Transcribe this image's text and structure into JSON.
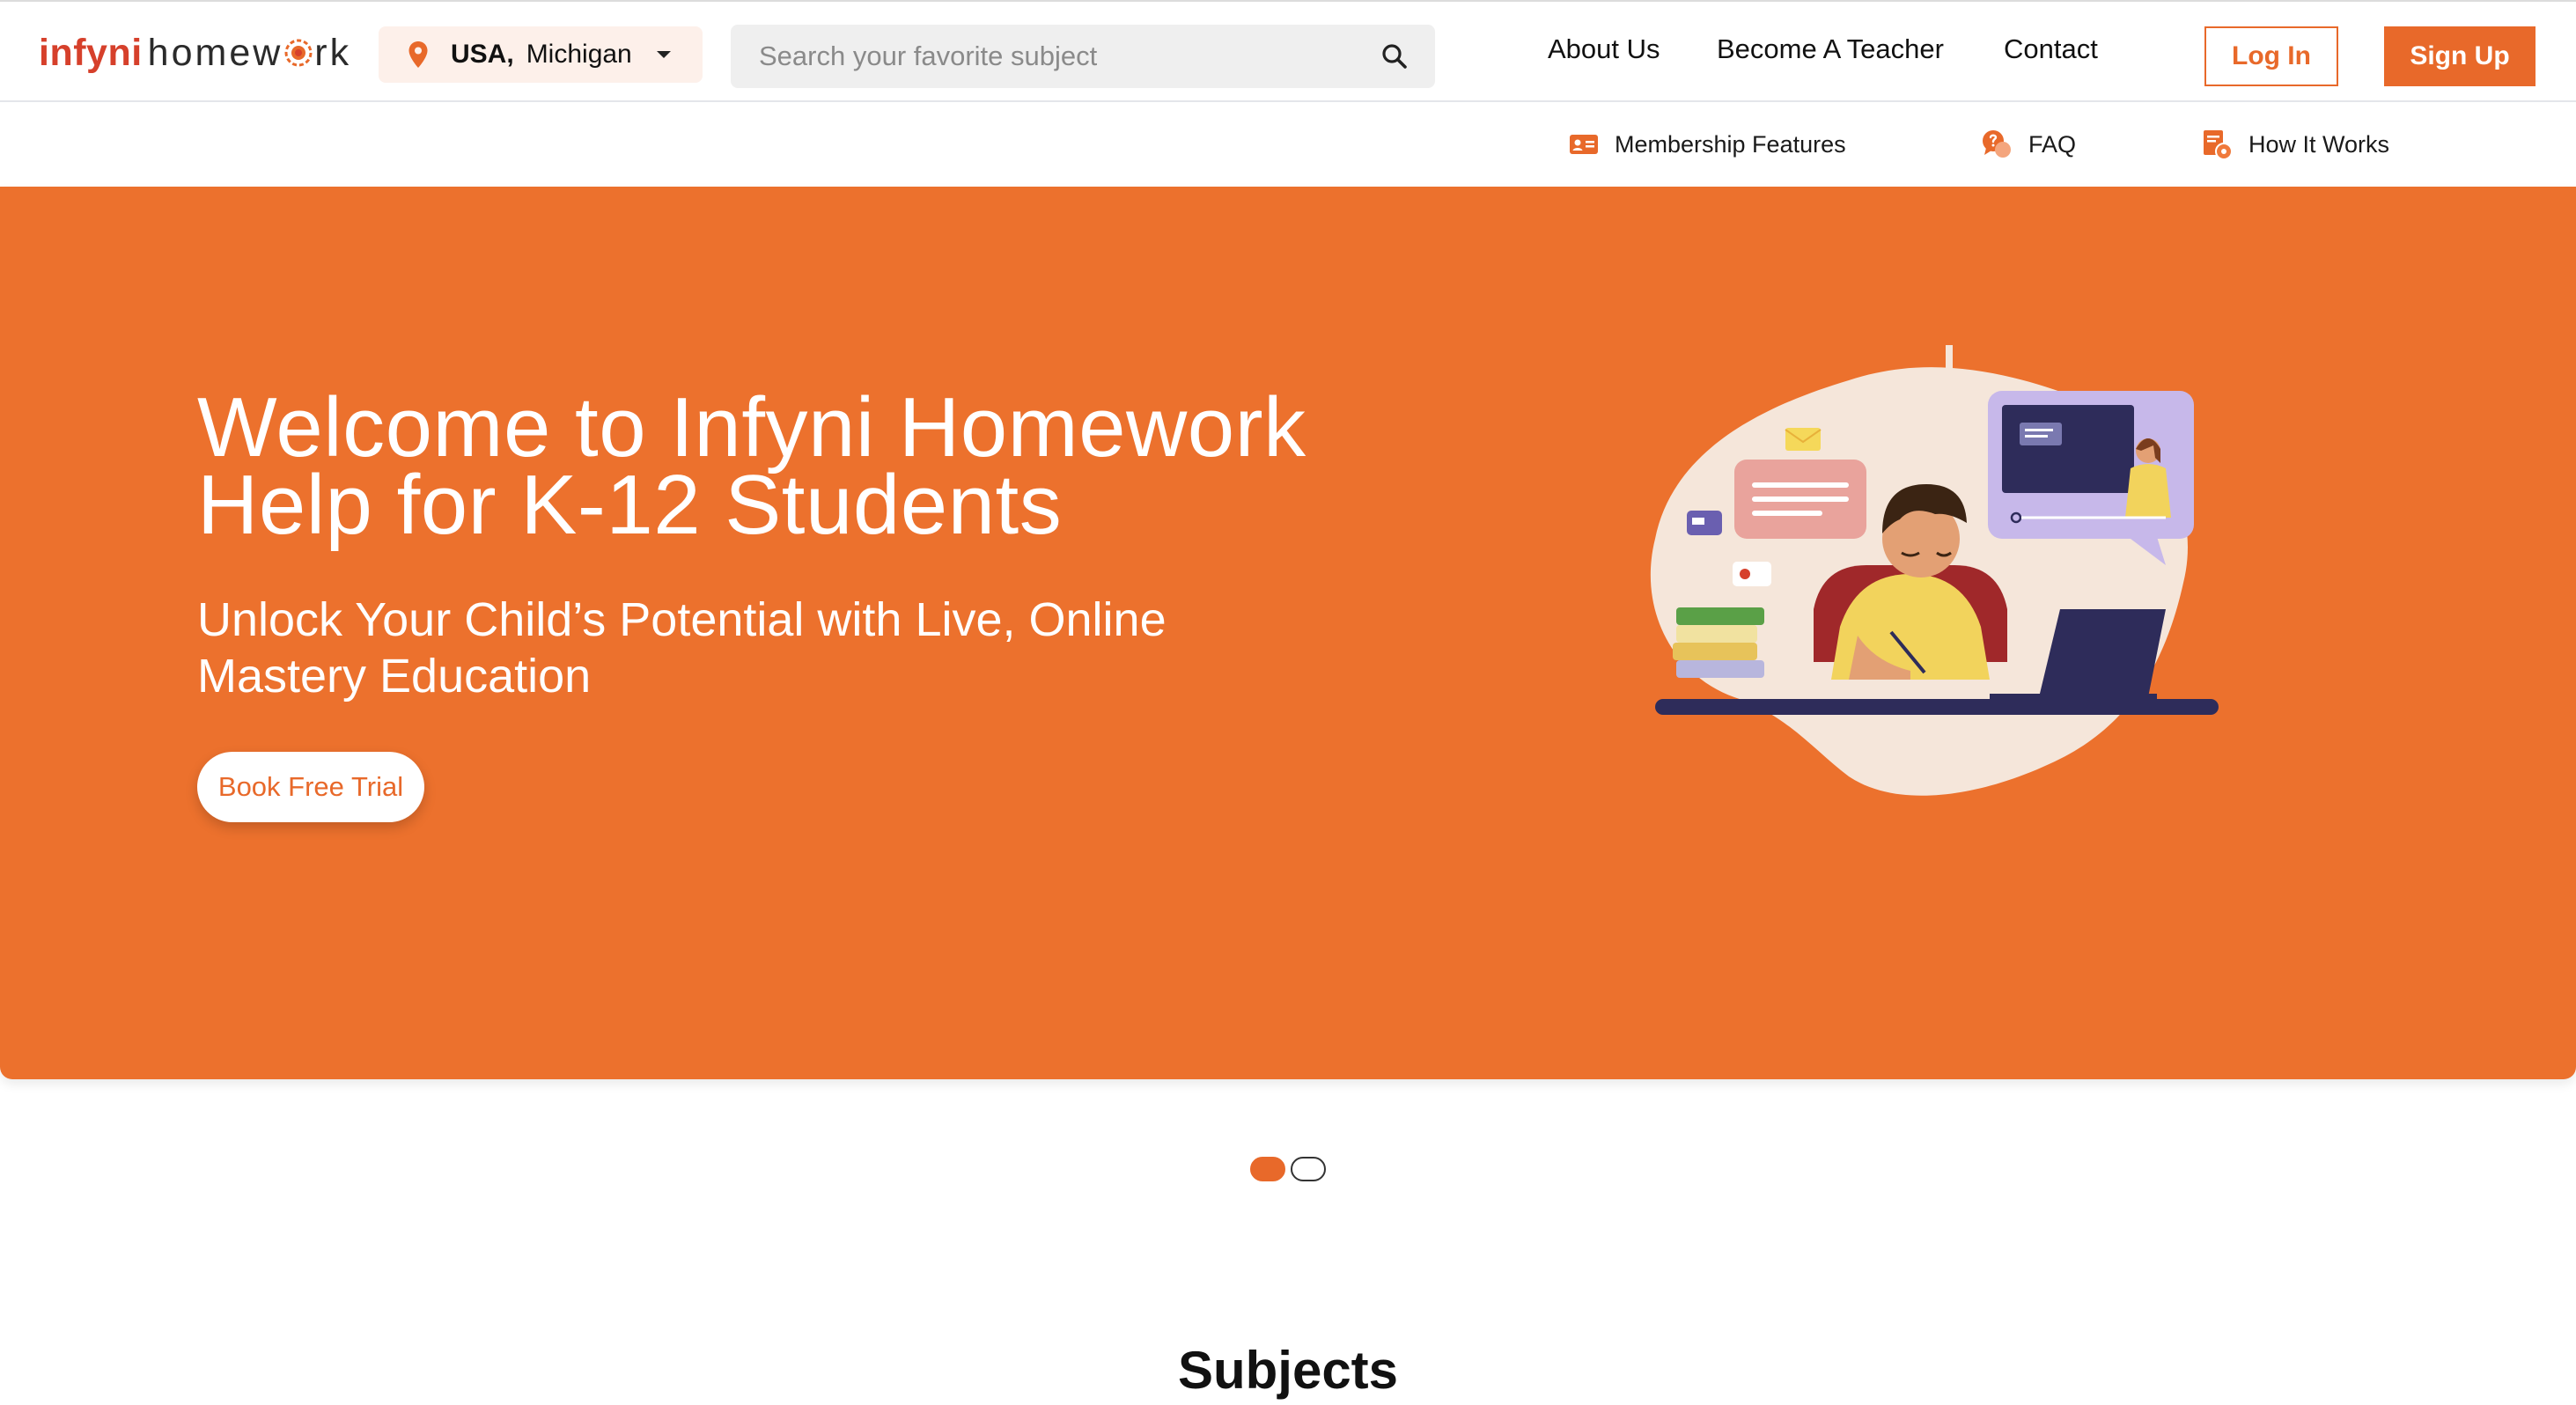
{
  "brand": {
    "name_part1": "infyni",
    "name_part2_a": "homew",
    "name_part2_b": "rk",
    "accent": "#e8692a",
    "logo_red": "#d6402b"
  },
  "location": {
    "country": "USA,",
    "state": "Michigan"
  },
  "search": {
    "placeholder": "Search your favorite subject"
  },
  "nav": {
    "about": "About Us",
    "teacher": "Become A Teacher",
    "contact": "Contact",
    "login": "Log In",
    "signup": "Sign Up"
  },
  "subnav": {
    "membership": "Membership Features",
    "faq": "FAQ",
    "how": "How It Works"
  },
  "hero": {
    "title": "Welcome to Infyni Homework Help for K-12 Students",
    "subtitle": "Unlock Your Child’s Potential with Live, Online Mastery Education",
    "cta": "Book Free Trial",
    "bg": "#ec712d"
  },
  "carousel": {
    "slides": 2,
    "active": 1
  },
  "section": {
    "subjects_title": "Subjects"
  }
}
